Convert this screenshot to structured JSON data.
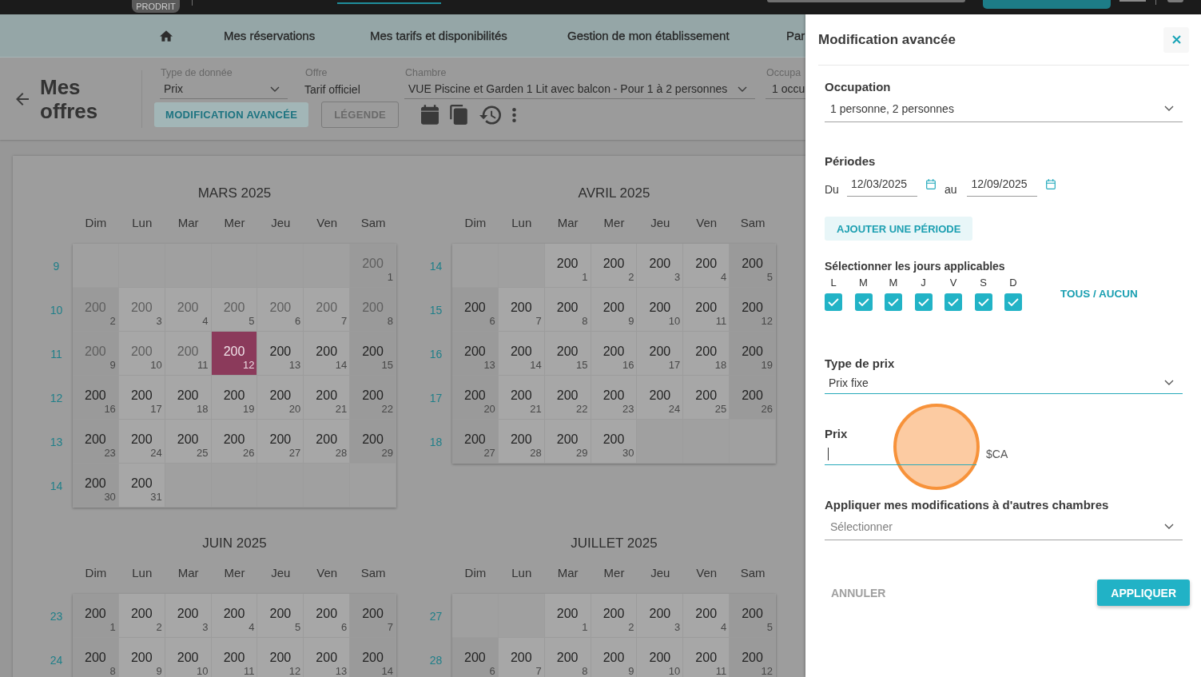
{
  "top_bar": {
    "badge": "PRODRIT"
  },
  "nav": {
    "items": [
      "Mes réservations",
      "Mes tarifs et disponibilités",
      "Gestion de mon établissement",
      "Par"
    ]
  },
  "toolbar": {
    "title": "Mes offres",
    "fields": [
      {
        "kind": "select",
        "label": "Type de donnée",
        "value": "Prix"
      },
      {
        "kind": "text",
        "label": "Offre",
        "value": "Tarif officiel"
      },
      {
        "kind": "select",
        "label": "Chambre",
        "value": "VUE Piscine et Garden 1 Lit avec balcon - Pour 1 à 2 personnes"
      },
      {
        "kind": "input",
        "label": "Occupa",
        "value": "1 occu"
      }
    ],
    "advanced_button": "MODIFICATION AVANCÉE",
    "legend_button": "LÉGENDE"
  },
  "calendars": [
    {
      "title": "MARS 2025",
      "weekdays": [
        "Dim",
        "Lun",
        "Mar",
        "Mer",
        "Jeu",
        "Ven",
        "Sam"
      ],
      "weeks": [
        {
          "number": "9",
          "days": [
            {
              "kind": "empty"
            },
            {
              "kind": "empty"
            },
            {
              "kind": "empty"
            },
            {
              "kind": "empty"
            },
            {
              "kind": "empty"
            },
            {
              "kind": "empty"
            },
            {
              "kind": "day",
              "price": "200",
              "day": "1",
              "past": true,
              "selected": false
            }
          ]
        },
        {
          "number": "10",
          "days": [
            {
              "kind": "day",
              "price": "200",
              "day": "2",
              "past": true,
              "selected": false
            },
            {
              "kind": "day",
              "price": "200",
              "day": "3",
              "past": true,
              "selected": false
            },
            {
              "kind": "day",
              "price": "200",
              "day": "4",
              "past": true,
              "selected": false
            },
            {
              "kind": "day",
              "price": "200",
              "day": "5",
              "past": true,
              "selected": false
            },
            {
              "kind": "day",
              "price": "200",
              "day": "6",
              "past": true,
              "selected": false
            },
            {
              "kind": "day",
              "price": "200",
              "day": "7",
              "past": true,
              "selected": false
            },
            {
              "kind": "day",
              "price": "200",
              "day": "8",
              "past": true,
              "selected": false
            }
          ]
        },
        {
          "number": "11",
          "days": [
            {
              "kind": "day",
              "price": "200",
              "day": "9",
              "past": true,
              "selected": false
            },
            {
              "kind": "day",
              "price": "200",
              "day": "10",
              "past": true,
              "selected": false
            },
            {
              "kind": "day",
              "price": "200",
              "day": "11",
              "past": true,
              "selected": false
            },
            {
              "kind": "day",
              "price": "200",
              "day": "12",
              "past": false,
              "selected": true
            },
            {
              "kind": "day",
              "price": "200",
              "day": "13",
              "past": false,
              "selected": false
            },
            {
              "kind": "day",
              "price": "200",
              "day": "14",
              "past": false,
              "selected": false
            },
            {
              "kind": "day",
              "price": "200",
              "day": "15",
              "past": false,
              "selected": false
            }
          ]
        },
        {
          "number": "12",
          "days": [
            {
              "kind": "day",
              "price": "200",
              "day": "16",
              "past": false,
              "selected": false
            },
            {
              "kind": "day",
              "price": "200",
              "day": "17",
              "past": false,
              "selected": false
            },
            {
              "kind": "day",
              "price": "200",
              "day": "18",
              "past": false,
              "selected": false
            },
            {
              "kind": "day",
              "price": "200",
              "day": "19",
              "past": false,
              "selected": false
            },
            {
              "kind": "day",
              "price": "200",
              "day": "20",
              "past": false,
              "selected": false
            },
            {
              "kind": "day",
              "price": "200",
              "day": "21",
              "past": false,
              "selected": false
            },
            {
              "kind": "day",
              "price": "200",
              "day": "22",
              "past": false,
              "selected": false
            }
          ]
        },
        {
          "number": "13",
          "days": [
            {
              "kind": "day",
              "price": "200",
              "day": "23",
              "past": false,
              "selected": false
            },
            {
              "kind": "day",
              "price": "200",
              "day": "24",
              "past": false,
              "selected": false
            },
            {
              "kind": "day",
              "price": "200",
              "day": "25",
              "past": false,
              "selected": false
            },
            {
              "kind": "day",
              "price": "200",
              "day": "26",
              "past": false,
              "selected": false
            },
            {
              "kind": "day",
              "price": "200",
              "day": "27",
              "past": false,
              "selected": false
            },
            {
              "kind": "day",
              "price": "200",
              "day": "28",
              "past": false,
              "selected": false
            },
            {
              "kind": "day",
              "price": "200",
              "day": "29",
              "past": false,
              "selected": false
            }
          ]
        },
        {
          "number": "14",
          "days": [
            {
              "kind": "day",
              "price": "200",
              "day": "30",
              "past": false,
              "selected": false
            },
            {
              "kind": "day",
              "price": "200",
              "day": "31",
              "past": false,
              "selected": false
            },
            {
              "kind": "empty"
            },
            {
              "kind": "empty"
            },
            {
              "kind": "empty"
            },
            {
              "kind": "empty"
            },
            {
              "kind": "empty"
            }
          ]
        }
      ]
    },
    {
      "title": "AVRIL 2025",
      "weekdays": [
        "Dim",
        "Lun",
        "Mar",
        "Mer",
        "Jeu",
        "Ven",
        "Sam"
      ],
      "weeks": [
        {
          "number": "14",
          "days": [
            {
              "kind": "empty"
            },
            {
              "kind": "empty"
            },
            {
              "kind": "day",
              "price": "200",
              "day": "1",
              "past": false,
              "selected": false
            },
            {
              "kind": "day",
              "price": "200",
              "day": "2",
              "past": false,
              "selected": false
            },
            {
              "kind": "day",
              "price": "200",
              "day": "3",
              "past": false,
              "selected": false
            },
            {
              "kind": "day",
              "price": "200",
              "day": "4",
              "past": false,
              "selected": false
            },
            {
              "kind": "day",
              "price": "200",
              "day": "5",
              "past": false,
              "selected": false
            }
          ]
        },
        {
          "number": "15",
          "days": [
            {
              "kind": "day",
              "price": "200",
              "day": "6",
              "past": false,
              "selected": false
            },
            {
              "kind": "day",
              "price": "200",
              "day": "7",
              "past": false,
              "selected": false
            },
            {
              "kind": "day",
              "price": "200",
              "day": "8",
              "past": false,
              "selected": false
            },
            {
              "kind": "day",
              "price": "200",
              "day": "9",
              "past": false,
              "selected": false
            },
            {
              "kind": "day",
              "price": "200",
              "day": "10",
              "past": false,
              "selected": false
            },
            {
              "kind": "day",
              "price": "200",
              "day": "11",
              "past": false,
              "selected": false
            },
            {
              "kind": "day",
              "price": "200",
              "day": "12",
              "past": false,
              "selected": false
            }
          ]
        },
        {
          "number": "16",
          "days": [
            {
              "kind": "day",
              "price": "200",
              "day": "13",
              "past": false,
              "selected": false
            },
            {
              "kind": "day",
              "price": "200",
              "day": "14",
              "past": false,
              "selected": false
            },
            {
              "kind": "day",
              "price": "200",
              "day": "15",
              "past": false,
              "selected": false
            },
            {
              "kind": "day",
              "price": "200",
              "day": "16",
              "past": false,
              "selected": false
            },
            {
              "kind": "day",
              "price": "200",
              "day": "17",
              "past": false,
              "selected": false
            },
            {
              "kind": "day",
              "price": "200",
              "day": "18",
              "past": false,
              "selected": false
            },
            {
              "kind": "day",
              "price": "200",
              "day": "19",
              "past": false,
              "selected": false
            }
          ]
        },
        {
          "number": "17",
          "days": [
            {
              "kind": "day",
              "price": "200",
              "day": "20",
              "past": false,
              "selected": false
            },
            {
              "kind": "day",
              "price": "200",
              "day": "21",
              "past": false,
              "selected": false
            },
            {
              "kind": "day",
              "price": "200",
              "day": "22",
              "past": false,
              "selected": false
            },
            {
              "kind": "day",
              "price": "200",
              "day": "23",
              "past": false,
              "selected": false
            },
            {
              "kind": "day",
              "price": "200",
              "day": "24",
              "past": false,
              "selected": false
            },
            {
              "kind": "day",
              "price": "200",
              "day": "25",
              "past": false,
              "selected": false
            },
            {
              "kind": "day",
              "price": "200",
              "day": "26",
              "past": false,
              "selected": false
            }
          ]
        },
        {
          "number": "18",
          "days": [
            {
              "kind": "day",
              "price": "200",
              "day": "27",
              "past": false,
              "selected": false
            },
            {
              "kind": "day",
              "price": "200",
              "day": "28",
              "past": false,
              "selected": false
            },
            {
              "kind": "day",
              "price": "200",
              "day": "29",
              "past": false,
              "selected": false
            },
            {
              "kind": "day",
              "price": "200",
              "day": "30",
              "past": false,
              "selected": false
            },
            {
              "kind": "empty"
            },
            {
              "kind": "empty"
            },
            {
              "kind": "empty"
            }
          ]
        }
      ]
    },
    {
      "title": "JUIN 2025",
      "weekdays": [
        "Dim",
        "Lun",
        "Mar",
        "Mer",
        "Jeu",
        "Ven",
        "Sam"
      ],
      "weeks": [
        {
          "number": "23",
          "days": [
            {
              "kind": "day",
              "price": "200",
              "day": "1",
              "past": false,
              "selected": false
            },
            {
              "kind": "day",
              "price": "200",
              "day": "2",
              "past": false,
              "selected": false
            },
            {
              "kind": "day",
              "price": "200",
              "day": "3",
              "past": false,
              "selected": false
            },
            {
              "kind": "day",
              "price": "200",
              "day": "4",
              "past": false,
              "selected": false
            },
            {
              "kind": "day",
              "price": "200",
              "day": "5",
              "past": false,
              "selected": false
            },
            {
              "kind": "day",
              "price": "200",
              "day": "6",
              "past": false,
              "selected": false
            },
            {
              "kind": "day",
              "price": "200",
              "day": "7",
              "past": false,
              "selected": false
            }
          ]
        },
        {
          "number": "24",
          "days": [
            {
              "kind": "day",
              "price": "200",
              "day": "8",
              "past": false,
              "selected": false
            },
            {
              "kind": "day",
              "price": "200",
              "day": "9",
              "past": false,
              "selected": false
            },
            {
              "kind": "day",
              "price": "200",
              "day": "10",
              "past": false,
              "selected": false
            },
            {
              "kind": "day",
              "price": "200",
              "day": "11",
              "past": false,
              "selected": false
            },
            {
              "kind": "day",
              "price": "200",
              "day": "12",
              "past": false,
              "selected": false
            },
            {
              "kind": "day",
              "price": "200",
              "day": "13",
              "past": false,
              "selected": false
            },
            {
              "kind": "day",
              "price": "200",
              "day": "14",
              "past": false,
              "selected": false
            }
          ]
        }
      ]
    },
    {
      "title": "JUILLET 2025",
      "weekdays": [
        "Dim",
        "Lun",
        "Mar",
        "Mer",
        "Jeu",
        "Ven",
        "Sam"
      ],
      "weeks": [
        {
          "number": "27",
          "days": [
            {
              "kind": "empty"
            },
            {
              "kind": "empty"
            },
            {
              "kind": "day",
              "price": "200",
              "day": "1",
              "past": false,
              "selected": false
            },
            {
              "kind": "day",
              "price": "200",
              "day": "2",
              "past": false,
              "selected": false
            },
            {
              "kind": "day",
              "price": "200",
              "day": "3",
              "past": false,
              "selected": false
            },
            {
              "kind": "day",
              "price": "200",
              "day": "4",
              "past": false,
              "selected": false
            },
            {
              "kind": "day",
              "price": "200",
              "day": "5",
              "past": false,
              "selected": false
            }
          ]
        },
        {
          "number": "28",
          "days": [
            {
              "kind": "day",
              "price": "200",
              "day": "6",
              "past": false,
              "selected": false
            },
            {
              "kind": "day",
              "price": "200",
              "day": "7",
              "past": false,
              "selected": false
            },
            {
              "kind": "day",
              "price": "200",
              "day": "8",
              "past": false,
              "selected": false
            },
            {
              "kind": "day",
              "price": "200",
              "day": "9",
              "past": false,
              "selected": false
            },
            {
              "kind": "day",
              "price": "200",
              "day": "10",
              "past": false,
              "selected": false
            },
            {
              "kind": "day",
              "price": "200",
              "day": "11",
              "past": false,
              "selected": false
            },
            {
              "kind": "day",
              "price": "200",
              "day": "12",
              "past": false,
              "selected": false
            }
          ]
        }
      ]
    }
  ],
  "panel": {
    "title": "Modification avancée",
    "occupation": {
      "label": "Occupation",
      "value": "1 personne, 2 personnes",
      "active": false
    },
    "periods": {
      "label": "Périodes",
      "from_label": "Du",
      "from": "12/03/2025",
      "to_label": "au",
      "to": "12/09/2025"
    },
    "add_period_button": "AJOUTER UNE PÉRIODE",
    "days": {
      "label": "Sélectionner les jours applicables",
      "items": [
        {
          "letter": "L",
          "checked": true
        },
        {
          "letter": "M",
          "checked": true
        },
        {
          "letter": "M",
          "checked": true
        },
        {
          "letter": "J",
          "checked": true
        },
        {
          "letter": "V",
          "checked": true
        },
        {
          "letter": "S",
          "checked": true
        },
        {
          "letter": "D",
          "checked": true
        }
      ],
      "toggle_all": "TOUS / AUCUN"
    },
    "price_type": {
      "label": "Type de prix",
      "value": "Prix fixe",
      "active": true
    },
    "price": {
      "label": "Prix",
      "unit": "$CA",
      "active": true
    },
    "other_rooms": {
      "label": "Appliquer mes modifications à d'autres chambres",
      "placeholder": "Sélectionner",
      "active": false
    },
    "cancel_button": "ANNULER",
    "apply_button": "APPLIQUER"
  }
}
